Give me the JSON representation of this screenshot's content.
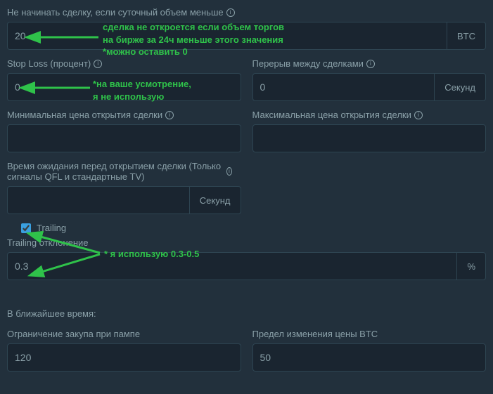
{
  "daily_volume": {
    "label": "Не начинать сделку, если суточный объем меньше",
    "value": "20",
    "suffix": "BTC"
  },
  "stop_loss": {
    "label": "Stop Loss (процент)",
    "value": "0"
  },
  "break_between": {
    "label": "Перерыв между сделками",
    "value": "0",
    "suffix": "Секунд"
  },
  "min_open_price": {
    "label": "Минимальная цена открытия сделки",
    "value": ""
  },
  "max_open_price": {
    "label": "Максимальная цена открытия сделки",
    "value": ""
  },
  "wait_time": {
    "label": "Время ожидания перед открытием сделки (Только сигналы QFL и стандартные TV)",
    "value": "",
    "suffix": "Секунд"
  },
  "trailing": {
    "checkbox_label": "Trailing",
    "checked": true,
    "deviation_label": "Trailing отклонение",
    "deviation_value": "0.3",
    "suffix": "%"
  },
  "coming_soon": {
    "title": "В ближайшее время:",
    "pump_limit": {
      "label": "Ограничение закупа при пампе",
      "value": "120"
    },
    "btc_price_limit": {
      "label": "Предел изменения цены BTC",
      "value": "50"
    }
  },
  "annotations": {
    "vol": "сделка не откроется если объем торгов\nна бирже за 24ч меньше этого значения\n*можно оставить 0",
    "sl": "*на ваше усмотрение,\nя не использую",
    "trailing": "* я использую 0.3-0.5"
  }
}
